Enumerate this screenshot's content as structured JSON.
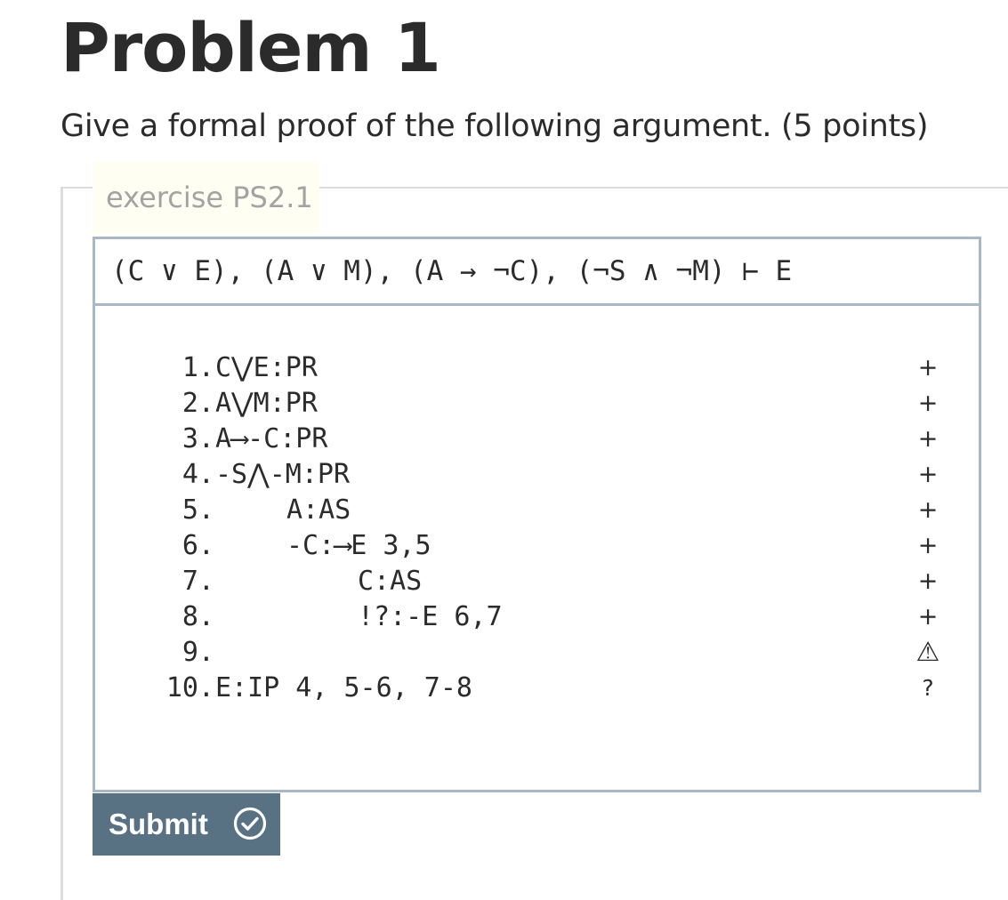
{
  "problem": {
    "title": "Problem 1",
    "instructions": "Give a formal proof of the following argument. (5 points)"
  },
  "exercise": {
    "legend": "exercise PS2.1",
    "argument": "(C ∨ E), (A ∨ M), (A → ¬C), (¬S ∧ ¬M) ⊢ E"
  },
  "proof": {
    "lines": [
      {
        "num": "1.",
        "text": "C⋁E:PR",
        "depth": 0,
        "status": "+"
      },
      {
        "num": "2.",
        "text": "A⋁M:PR",
        "depth": 0,
        "status": "+"
      },
      {
        "num": "3.",
        "text": "A⟶-C:PR",
        "depth": 0,
        "status": "+"
      },
      {
        "num": "4.",
        "text": "-S⋀-M:PR",
        "depth": 0,
        "status": "+"
      },
      {
        "num": "5.",
        "text": "A:AS",
        "depth": 1,
        "status": "+"
      },
      {
        "num": "6.",
        "text": "-C:⟶E 3,5",
        "depth": 1,
        "status": "+"
      },
      {
        "num": "7.",
        "text": "C:AS",
        "depth": 2,
        "status": "+"
      },
      {
        "num": "8.",
        "text": "!?:-E 6,7",
        "depth": 2,
        "status": "+"
      },
      {
        "num": "9.",
        "text": "",
        "depth": 0,
        "status": "⚠"
      },
      {
        "num": "10.",
        "text": "E:IP 4, 5-6, 7-8",
        "depth": 0,
        "status": "?"
      }
    ]
  },
  "submit": {
    "label": "Submit",
    "icon": "check-circle-icon"
  },
  "colors": {
    "submit_bg": "#587283",
    "box_border": "#a9b8c4",
    "legend_bg": "#fffef3",
    "legend_text": "#a3a3a3"
  }
}
